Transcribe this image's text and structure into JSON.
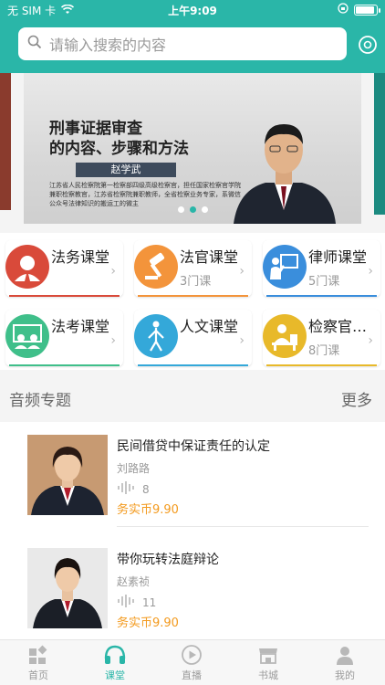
{
  "status_bar": {
    "carrier": "无 SIM 卡",
    "time": "上午9:09"
  },
  "search": {
    "placeholder": "请输入搜索的内容"
  },
  "banner": {
    "title_line1": "刑事证据审查",
    "title_line2": "的内容、步骤和方法",
    "speaker": "赵学武",
    "description": "江苏省人民检察院第一检察部四级高级检察官，担任国家检察官学院兼职检察教官，江苏省检察院兼职教师，全省检察业务专家，系微信公众号法律知识的搬运工的微主",
    "dots": 3,
    "active_dot": 1
  },
  "categories": [
    {
      "label": "法务课堂",
      "count": "",
      "icon": "judge-icon",
      "color": "#d94a3a"
    },
    {
      "label": "法官课堂",
      "count": "3门课",
      "icon": "gavel-icon",
      "color": "#f3943b"
    },
    {
      "label": "律师课堂",
      "count": "5门课",
      "icon": "lecture-icon",
      "color": "#3a8edc"
    },
    {
      "label": "法考课堂",
      "count": "",
      "icon": "people-icon",
      "color": "#3fbf8a"
    },
    {
      "label": "人文课堂",
      "count": "",
      "icon": "body-icon",
      "color": "#34a8d9"
    },
    {
      "label": "检察官…",
      "count": "8门课",
      "icon": "desk-icon",
      "color": "#e8b92a"
    }
  ],
  "section": {
    "title": "音频专题",
    "more": "更多"
  },
  "audio_items": [
    {
      "title": "民间借贷中保证责任的认定",
      "author": "刘路路",
      "plays": "8",
      "price": "务实币9.90"
    },
    {
      "title": "带你玩转法庭辩论",
      "author": "赵素祯",
      "plays": "11",
      "price": "务实币9.90"
    }
  ],
  "nav": [
    {
      "label": "首页",
      "icon": "home-icon",
      "active": false
    },
    {
      "label": "课堂",
      "icon": "headphones-icon",
      "active": true
    },
    {
      "label": "直播",
      "icon": "play-icon",
      "active": false
    },
    {
      "label": "书城",
      "icon": "store-icon",
      "active": false
    },
    {
      "label": "我的",
      "icon": "profile-icon",
      "active": false
    }
  ],
  "colors": {
    "accent": "#2ab6a8",
    "price": "#f39a1e"
  }
}
